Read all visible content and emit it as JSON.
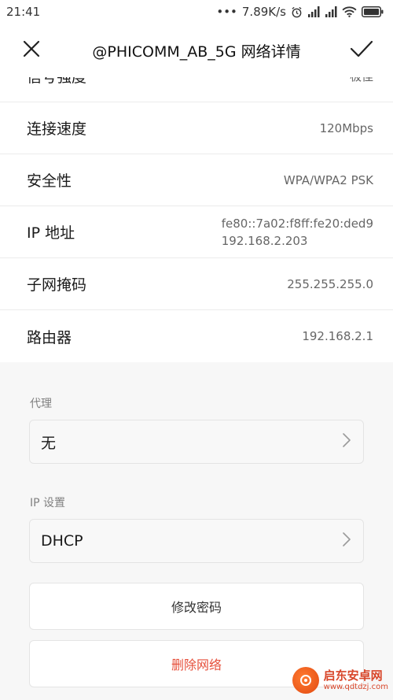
{
  "status_bar": {
    "time": "21:41",
    "dots": "•••",
    "speed": "7.89K/s"
  },
  "header": {
    "title": "@PHICOMM_AB_5G  网络详情"
  },
  "details": [
    {
      "label": "信号强度",
      "value": "极佳"
    },
    {
      "label": "连接速度",
      "value": "120Mbps"
    },
    {
      "label": "安全性",
      "value": "WPA/WPA2 PSK"
    },
    {
      "label": "IP 地址",
      "value": "fe80::7a02:f8ff:fe20:ded9",
      "value2": "192.168.2.203"
    },
    {
      "label": "子网掩码",
      "value": "255.255.255.0"
    },
    {
      "label": "路由器",
      "value": "192.168.2.1"
    }
  ],
  "proxy": {
    "label": "代理",
    "value": "无"
  },
  "ip_settings": {
    "label": "IP 设置",
    "value": "DHCP"
  },
  "actions": {
    "modify_password": "修改密码",
    "delete_network": "删除网络"
  },
  "watermark": {
    "title": "启东安卓网",
    "url": "www.qdtdzj.com"
  },
  "colors": {
    "danger": "#e6503c",
    "background": "#f7f7f7"
  }
}
